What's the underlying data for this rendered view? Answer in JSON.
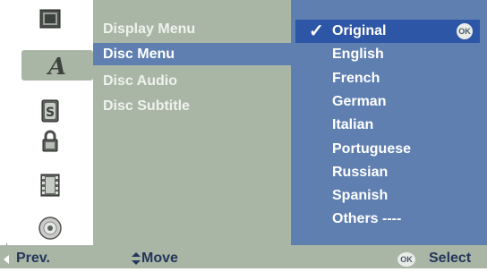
{
  "icons": [
    {
      "name": "display-icon"
    },
    {
      "name": "language-icon"
    },
    {
      "name": "audio-icon"
    },
    {
      "name": "lock-icon"
    },
    {
      "name": "film-icon"
    },
    {
      "name": "disc-icon"
    }
  ],
  "menu": {
    "items": [
      {
        "label": "Display Menu"
      },
      {
        "label": "Disc Menu"
      },
      {
        "label": "Disc Audio"
      },
      {
        "label": "Disc Subtitle"
      }
    ],
    "active_index": 1
  },
  "options": {
    "selected": {
      "label": "Original",
      "check": "✓",
      "ok": "OK"
    },
    "items": [
      {
        "label": "English"
      },
      {
        "label": "French"
      },
      {
        "label": "German"
      },
      {
        "label": "Italian"
      },
      {
        "label": "Portuguese"
      },
      {
        "label": "Russian"
      },
      {
        "label": "Spanish"
      },
      {
        "label": "Others ----"
      }
    ]
  },
  "footer": {
    "prev_label": "Prev.",
    "move_label": "Move",
    "ok_label": "OK",
    "select_label": "Select"
  },
  "colors": {
    "menu_bg": "#a9b6a6",
    "active_bg": "#5f7fb0",
    "selected_bg": "#2e56a6"
  }
}
